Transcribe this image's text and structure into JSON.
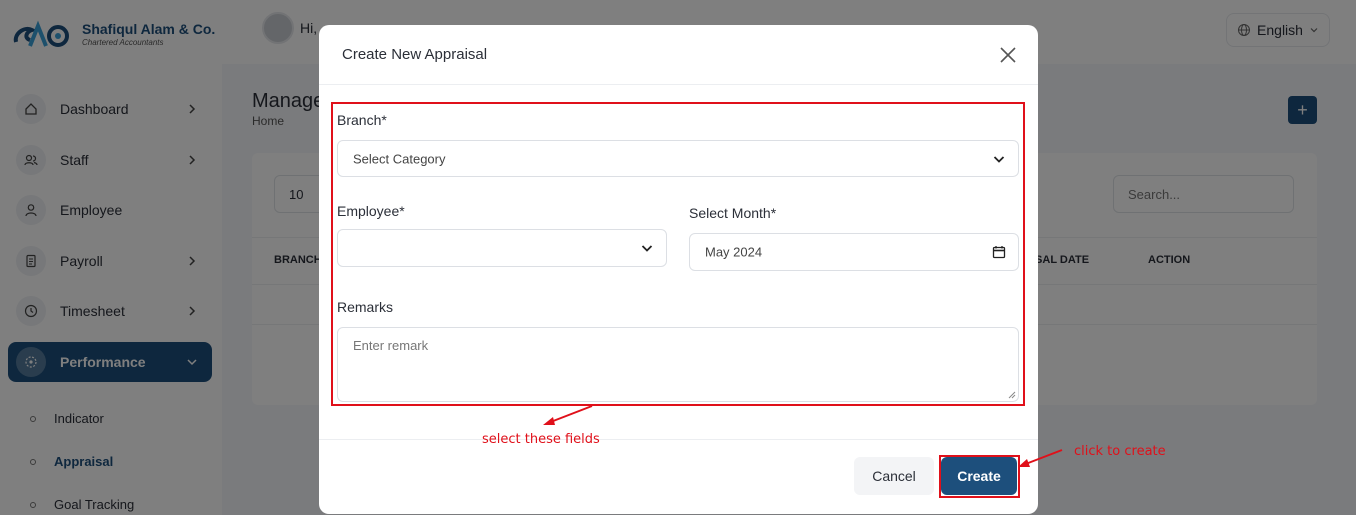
{
  "brand": {
    "name": "Shafiqul Alam & Co.",
    "subtitle": "Chartered Accountants"
  },
  "topbar": {
    "greeting": "Hi,",
    "language": "English"
  },
  "sidebar": {
    "items": [
      {
        "label": "Dashboard",
        "icon": "home-icon"
      },
      {
        "label": "Staff",
        "icon": "users-icon"
      },
      {
        "label": "Employee",
        "icon": "user-icon"
      },
      {
        "label": "Payroll",
        "icon": "receipt-icon"
      },
      {
        "label": "Timesheet",
        "icon": "clock-icon"
      },
      {
        "label": "Performance",
        "icon": "performance-icon",
        "active": true
      }
    ],
    "subitems": [
      {
        "label": "Indicator"
      },
      {
        "label": "Appraisal",
        "active": true
      },
      {
        "label": "Goal Tracking"
      }
    ]
  },
  "page": {
    "title": "Manage",
    "breadcrumb": "Home",
    "add_button": "+",
    "per_page": "10",
    "search_placeholder": "Search...",
    "columns": [
      "BRANCH",
      "ISAL DATE",
      "ACTION"
    ]
  },
  "modal": {
    "title": "Create New Appraisal",
    "branch_label": "Branch*",
    "branch_value": "Select Category",
    "employee_label": "Employee*",
    "employee_value": "",
    "month_label": "Select Month*",
    "month_value": "May 2024",
    "remarks_label": "Remarks",
    "remarks_placeholder": "Enter remark",
    "cancel_label": "Cancel",
    "create_label": "Create"
  },
  "annotations": {
    "fields_note": "select these fields",
    "create_note": "click to create",
    "color": "#e0101a"
  },
  "colors": {
    "primary": "#1d4f7c",
    "accent_red": "#e0101a"
  }
}
